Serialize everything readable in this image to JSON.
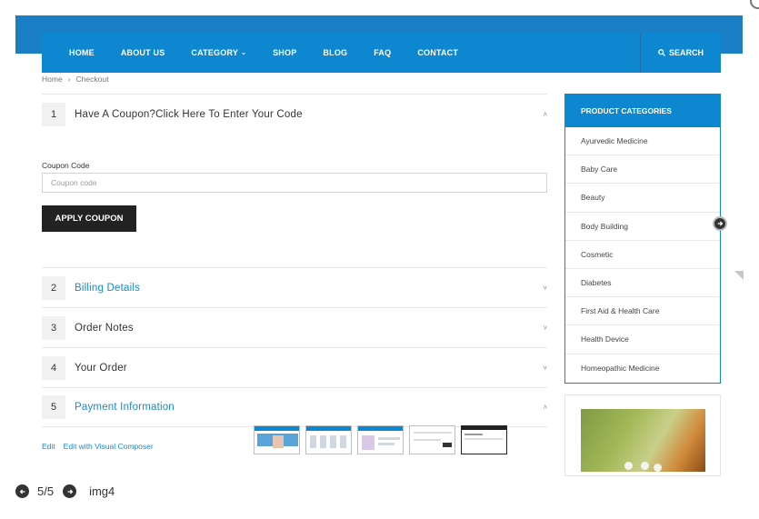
{
  "nav": {
    "items": [
      "HOME",
      "ABOUT US",
      "CATEGORY",
      "SHOP",
      "BLOG",
      "FAQ",
      "CONTACT"
    ],
    "search_label": "SEARCH",
    "color": "#0d87d0"
  },
  "breadcrumb": {
    "home": "Home",
    "separator": "›",
    "current": "Checkout"
  },
  "accordion": [
    {
      "num": "1",
      "title": "Have A Coupon?Click Here To Enter Your Code",
      "state": "expanded"
    },
    {
      "num": "2",
      "title": "Billing Details",
      "state": "collapsed"
    },
    {
      "num": "3",
      "title": "Order Notes",
      "state": "collapsed"
    },
    {
      "num": "4",
      "title": "Your Order",
      "state": "collapsed"
    },
    {
      "num": "5",
      "title": "Payment Information",
      "state": "expanded"
    }
  ],
  "coupon": {
    "label": "Coupon Code",
    "placeholder": "Coupon code",
    "button": "APPLY COUPON"
  },
  "edit_links": {
    "edit": "Edit",
    "visual": "Edit with Visual Composer"
  },
  "sidebar": {
    "title": "PRODUCT CATEGORIES",
    "categories": [
      "Ayurvedic Medicine",
      "Baby Care",
      "Beauty",
      "Body Building",
      "Cosmetic",
      "Diabetes",
      "First Aid & Health Care",
      "Health Device",
      "Homeopathic Medicine"
    ]
  },
  "gallery": {
    "counter": "5/5",
    "caption": "img4",
    "thumb_count": 5,
    "active_index": 5
  },
  "icons": {
    "prev": "arrow-left-circle-icon",
    "next": "arrow-right-circle-icon",
    "search": "search-icon",
    "chevron": "chevron-icon"
  }
}
